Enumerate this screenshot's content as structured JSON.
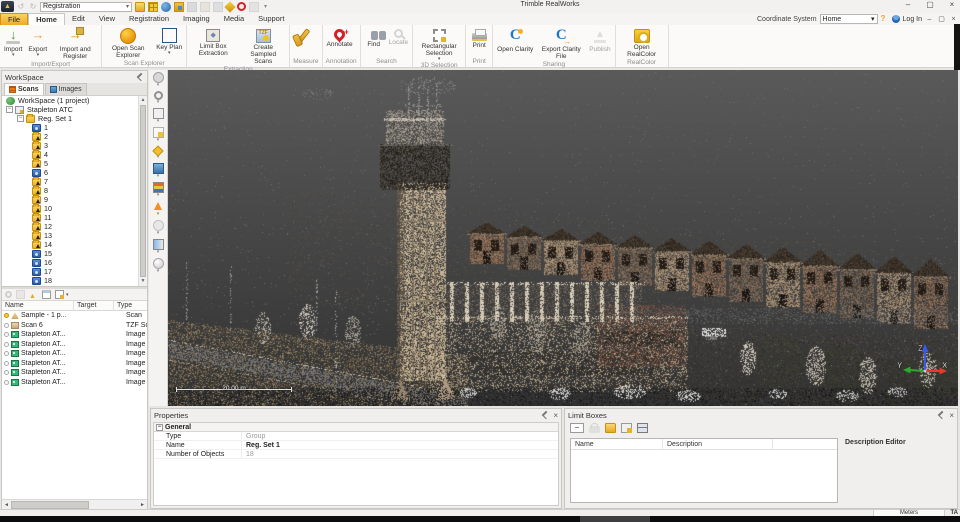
{
  "window": {
    "title": "Trimble RealWorks"
  },
  "quick_access": {
    "workflow": "Registration",
    "icons": [
      {
        "icon": "folder-gold-icon"
      },
      {
        "icon": "grid-gold-icon"
      },
      {
        "icon": "globe-icon"
      },
      {
        "icon": "image-folder-icon"
      },
      {
        "icon": "save-icon",
        "disabled": true
      },
      {
        "icon": "open-doc-icon",
        "disabled": true
      },
      {
        "icon": "save-all-icon",
        "disabled": true
      },
      {
        "icon": "pencil-gold-icon"
      },
      {
        "icon": "registration-red-icon"
      },
      {
        "icon": "tool-gray-icon",
        "disabled": true
      },
      {
        "icon": "overflow-icon"
      }
    ]
  },
  "menu": {
    "tabs": [
      {
        "label": "File",
        "file": true
      },
      {
        "label": "Home",
        "active": true
      },
      {
        "label": "Edit"
      },
      {
        "label": "View"
      },
      {
        "label": "Registration"
      },
      {
        "label": "Imaging"
      },
      {
        "label": "Media"
      },
      {
        "label": "Support"
      }
    ],
    "coordinate_system_label": "Coordinate System",
    "coordinate_system_value": "Home",
    "login": "Log In"
  },
  "ribbon": {
    "groups": [
      {
        "label": "Import/Export",
        "buttons": [
          {
            "label": "Import",
            "icon": "import-icon",
            "dropdown": true
          },
          {
            "label": "Export",
            "icon": "export-icon",
            "dropdown": true
          },
          {
            "label": "Import and Register",
            "icon": "import-register-icon"
          }
        ]
      },
      {
        "label": "Scan Explorer",
        "buttons": [
          {
            "label": "Open Scan Explorer",
            "icon": "scan-explorer-icon"
          },
          {
            "label": "Key Plan",
            "icon": "key-plan-icon",
            "dropdown": true
          }
        ]
      },
      {
        "label": "Extraction",
        "buttons": [
          {
            "label": "Limit Box Extraction",
            "icon": "limit-box-icon"
          },
          {
            "label": "Create Sampled Scans",
            "icon": "sampled-scans-icon"
          }
        ]
      },
      {
        "label": "Measure",
        "buttons": [
          {
            "label": "",
            "icon": "measure-icon"
          }
        ]
      },
      {
        "label": "Annotation",
        "buttons": [
          {
            "label": "Annotate",
            "icon": "annotate-icon"
          }
        ]
      },
      {
        "label": "Search",
        "buttons": [
          {
            "label": "Find",
            "icon": "find-icon"
          },
          {
            "label": "Locate",
            "icon": "locate-icon",
            "disabled": true
          }
        ]
      },
      {
        "label": "3D Selection",
        "buttons": [
          {
            "label": "Rectangular Selection",
            "icon": "rect-selection-icon",
            "dropdown": true
          }
        ]
      },
      {
        "label": "Print",
        "buttons": [
          {
            "label": "Print",
            "icon": "print-icon"
          }
        ]
      },
      {
        "label": "Sharing",
        "buttons": [
          {
            "label": "Open Clarity",
            "icon": "clarity-icon"
          },
          {
            "label": "Export Clarity File",
            "icon": "clarity-export-icon"
          },
          {
            "label": "Publish",
            "icon": "publish-icon",
            "disabled": true
          }
        ]
      },
      {
        "label": "RealColor",
        "buttons": [
          {
            "label": "Open RealColor",
            "icon": "realcolor-icon"
          }
        ]
      }
    ]
  },
  "workspace": {
    "title": "WorkSpace",
    "tabs": [
      {
        "label": "Scans",
        "icon": "scans-icon",
        "active": true
      },
      {
        "label": "Images",
        "icon": "images-icon"
      }
    ],
    "tree": [
      {
        "label": "WorkSpace  (1 project)",
        "icon": "project-icon",
        "depth": "d0"
      },
      {
        "label": "Stapleton ATC",
        "icon": "station-icon",
        "depth": "d0",
        "expander": true
      },
      {
        "label": "Reg. Set 1",
        "icon": "group-icon",
        "depth": "d1",
        "expander": true
      },
      {
        "label": "1",
        "icon": "station-scan-icon",
        "depth": "d2"
      },
      {
        "label": "2",
        "icon": "scan-folder-icon",
        "depth": "d2"
      },
      {
        "label": "3",
        "icon": "scan-folder-icon",
        "depth": "d2"
      },
      {
        "label": "4",
        "icon": "scan-folder-icon",
        "depth": "d2"
      },
      {
        "label": "5",
        "icon": "scan-folder-icon",
        "depth": "d2"
      },
      {
        "label": "6",
        "icon": "station-scan-icon",
        "depth": "d2"
      },
      {
        "label": "7",
        "icon": "scan-folder-icon",
        "depth": "d2"
      },
      {
        "label": "8",
        "icon": "scan-folder-icon",
        "depth": "d2"
      },
      {
        "label": "9",
        "icon": "scan-folder-icon",
        "depth": "d2"
      },
      {
        "label": "10",
        "icon": "scan-folder-icon",
        "depth": "d2"
      },
      {
        "label": "11",
        "icon": "scan-folder-icon",
        "depth": "d2"
      },
      {
        "label": "12",
        "icon": "scan-folder-icon",
        "depth": "d2"
      },
      {
        "label": "13",
        "icon": "scan-folder-icon",
        "depth": "d2"
      },
      {
        "label": "14",
        "icon": "scan-folder-icon",
        "depth": "d2"
      },
      {
        "label": "15",
        "icon": "station-scan-icon",
        "depth": "d2"
      },
      {
        "label": "16",
        "icon": "station-scan-icon",
        "depth": "d2"
      },
      {
        "label": "17",
        "icon": "station-scan-icon",
        "depth": "d2"
      },
      {
        "label": "18",
        "icon": "station-scan-icon",
        "depth": "d2"
      }
    ],
    "list_toolbar": [
      {
        "icon": "find-list-icon",
        "disabled": true
      },
      {
        "icon": "sync-list-icon",
        "disabled": true
      },
      {
        "icon": "move-up-icon"
      },
      {
        "icon": "list-view-icon",
        "dropdown": true
      },
      {
        "icon": "edit-columns-icon"
      }
    ],
    "list": {
      "columns": [
        "Name",
        "Target",
        "Type"
      ],
      "rows": [
        {
          "name": "Sample - 1 p...",
          "target": "",
          "type": "Scan",
          "bulb": "bulb-on",
          "icon": "sample-scan-icon"
        },
        {
          "name": "Scan 6",
          "target": "",
          "type": "TZF Scan",
          "bulb": "bulb-off",
          "icon": "tzf-file-icon"
        },
        {
          "name": "Stapleton AT...",
          "target": "",
          "type": "Image - M...",
          "bulb": "bulb-off",
          "icon": "match-image-icon"
        },
        {
          "name": "Stapleton AT...",
          "target": "",
          "type": "Image - M...",
          "bulb": "bulb-off",
          "icon": "match-image-icon"
        },
        {
          "name": "Stapleton AT...",
          "target": "",
          "type": "Image - M...",
          "bulb": "bulb-off",
          "icon": "match-image-icon"
        },
        {
          "name": "Stapleton AT...",
          "target": "",
          "type": "Image - M...",
          "bulb": "bulb-off",
          "icon": "match-image-icon"
        },
        {
          "name": "Stapleton AT...",
          "target": "",
          "type": "Image - M...",
          "bulb": "bulb-off",
          "icon": "match-image-icon"
        },
        {
          "name": "Stapleton AT...",
          "target": "",
          "type": "Image - M...",
          "bulb": "bulb-off",
          "icon": "match-image-icon"
        }
      ]
    }
  },
  "view_toolbar": [
    {
      "icon": "render-settings-icon"
    },
    {
      "icon": "zoom-tool-icon"
    },
    {
      "icon": "screen-fit-icon"
    },
    {
      "icon": "pick-point-icon"
    },
    {
      "icon": "target-star-icon"
    },
    {
      "icon": "image-plane-icon"
    },
    {
      "icon": "realcolor-image-icon"
    },
    {
      "icon": "cone-marker-icon"
    },
    {
      "icon": "lighting-icon"
    },
    {
      "icon": "pano-image-icon"
    },
    {
      "icon": "sphere-view-icon"
    }
  ],
  "viewport": {
    "scale_label": "20.00 m",
    "axis_x": "X",
    "axis_y": "Y",
    "axis_z": "Z"
  },
  "properties": {
    "title": "Properties",
    "section": "General",
    "rows": [
      {
        "label": "Type",
        "value": "Group",
        "muted": true
      },
      {
        "label": "Name",
        "value": "Reg. Set 1"
      },
      {
        "label": "Number of Objects",
        "value": "18",
        "muted": true
      }
    ]
  },
  "limit_boxes": {
    "title": "Limit Boxes",
    "toolbar": [
      {
        "icon": "minus-icon"
      },
      {
        "icon": "lock-icon",
        "disabled": true
      },
      {
        "icon": "folder-gold-icon"
      },
      {
        "icon": "edit-box-icon"
      },
      {
        "icon": "cube-icon"
      }
    ],
    "columns": [
      "Name",
      "Description"
    ],
    "editor_title": "Description Editor"
  },
  "status": {
    "units": "Meters",
    "annotation_toggle": "TA"
  }
}
